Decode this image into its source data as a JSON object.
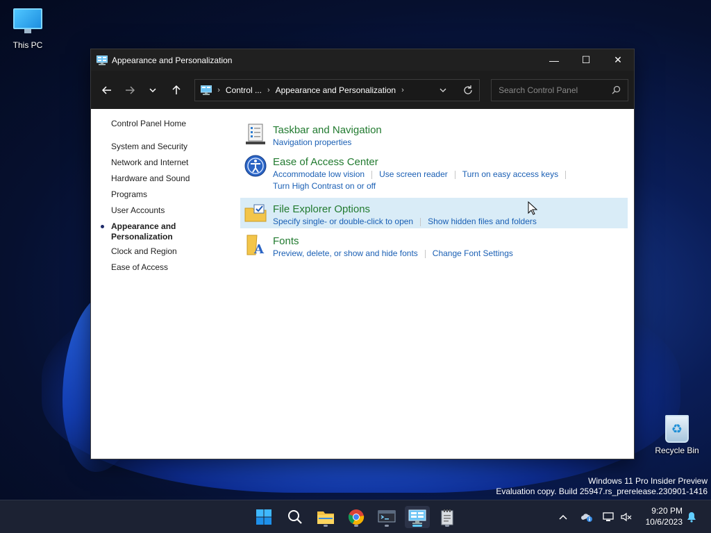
{
  "desktop": {
    "icons": [
      {
        "label": "This PC"
      },
      {
        "label": "Recycle Bin"
      }
    ],
    "watermark": {
      "line1": "Windows 11 Pro Insider Preview",
      "line2": "Evaluation copy. Build 25947.rs_prerelease.230901-1416"
    }
  },
  "window": {
    "title": "Appearance and Personalization",
    "controls": {
      "minimize": "—",
      "maximize": "☐",
      "close": "✕"
    },
    "address": {
      "segments": [
        "Control ...",
        "Appearance and Personalization"
      ],
      "separator": "›"
    },
    "search": {
      "placeholder": "Search Control Panel"
    },
    "left_nav": {
      "home": "Control Panel Home",
      "items": [
        "System and Security",
        "Network and Internet",
        "Hardware and Sound",
        "Programs",
        "User Accounts",
        "Appearance and Personalization",
        "Clock and Region",
        "Ease of Access"
      ],
      "active_index": 5
    },
    "categories": [
      {
        "title": "Taskbar and Navigation",
        "icon": "taskbar-icon",
        "links": [
          "Navigation properties"
        ]
      },
      {
        "title": "Ease of Access Center",
        "icon": "ease-of-access-icon",
        "links": [
          "Accommodate low vision",
          "Use screen reader",
          "Turn on easy access keys",
          "Turn High Contrast on or off"
        ]
      },
      {
        "title": "File Explorer Options",
        "icon": "folder-options-icon",
        "links": [
          "Specify single- or double-click to open",
          "Show hidden files and folders"
        ]
      },
      {
        "title": "Fonts",
        "icon": "fonts-icon",
        "links": [
          "Preview, delete, or show and hide fonts",
          "Change Font Settings"
        ]
      }
    ]
  },
  "taskbar": {
    "apps": [
      "start-icon",
      "search-icon",
      "file-explorer-icon",
      "chrome-icon",
      "terminal-icon",
      "control-panel-icon",
      "notepad-icon"
    ],
    "clock": {
      "time": "9:20 PM",
      "date": "10/6/2023"
    }
  },
  "colors": {
    "heading_green": "#217a2f",
    "link_blue": "#1a5fb4",
    "highlight": "#d9ecf7",
    "titlebar": "#202020"
  }
}
